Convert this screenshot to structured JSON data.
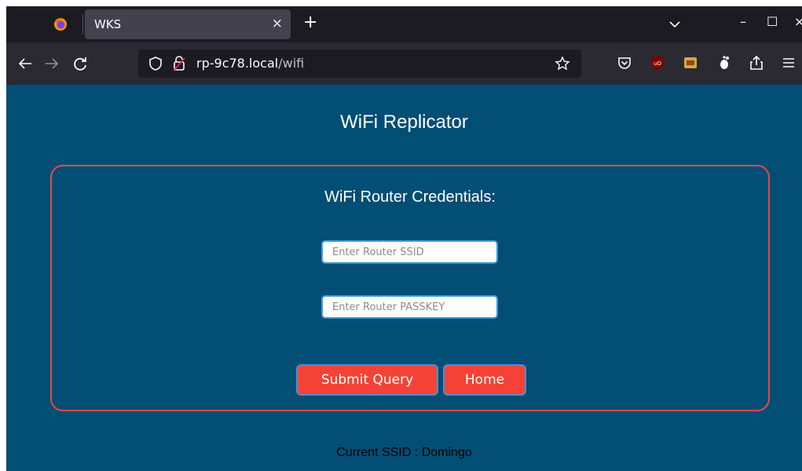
{
  "browser": {
    "tab": {
      "title": "WKS",
      "close": "×"
    },
    "new_tab": "+",
    "window_controls": {
      "minimize": "–",
      "maximize": "☐",
      "close": "×"
    },
    "url": {
      "host": "rp-9c78.local",
      "path": "/wifi"
    },
    "icons": [
      "firefox-icon",
      "back-icon",
      "forward-icon",
      "reload-icon",
      "shield-icon",
      "lock-icon",
      "star-icon",
      "pocket-icon",
      "ublock-icon",
      "extension-icon",
      "gnome-icon",
      "share-icon",
      "menu-icon"
    ]
  },
  "page": {
    "title": "WiFi Replicator",
    "form": {
      "heading": "WiFi Router Credentials:",
      "ssid": {
        "placeholder": "Enter Router SSID",
        "value": ""
      },
      "passkey": {
        "placeholder": "Enter Router PASSKEY",
        "value": ""
      },
      "submit_label": "Submit Query",
      "home_label": "Home"
    },
    "status": "Current SSID : Domingo"
  },
  "colors": {
    "page_bg": "#034e74",
    "card_border": "#e04b4b",
    "button_bg": "#f44336",
    "field_border": "#3a9bd8"
  }
}
